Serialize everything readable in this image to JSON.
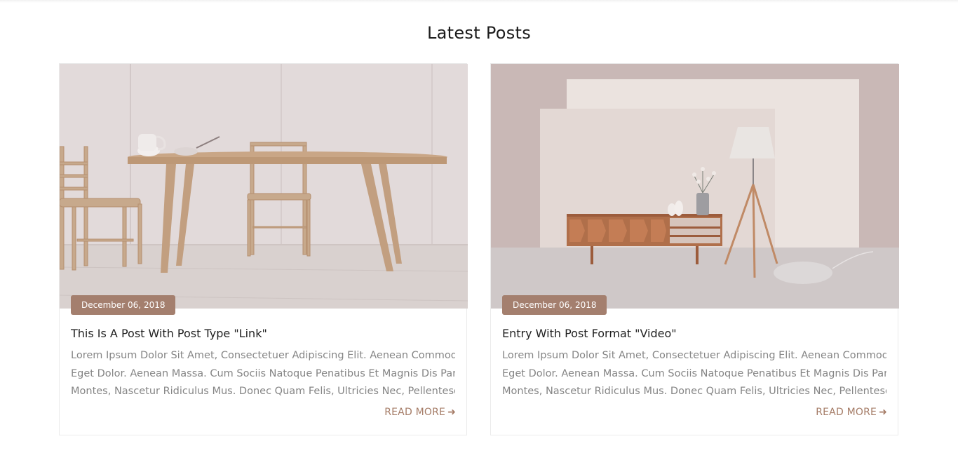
{
  "section": {
    "title": "Latest Posts"
  },
  "posts": [
    {
      "date": "December 06, 2018",
      "title": "This Is A Post With Post Type \"Link\"",
      "excerpt_lines": [
        "Lorem Ipsum Dolor Sit Amet, Consectetuer Adipiscing Elit. Aenean Commodo Ligula",
        "Eget Dolor. Aenean Massa. Cum Sociis Natoque Penatibus Et Magnis Dis Parturient",
        "Montes, Nascetur Ridiculus Mus. Donec Quam Felis, Ultricies Nec, Pellentesque Eu,.."
      ],
      "read_more": "READ MORE",
      "arrow_icon": "arrow-right-icon"
    },
    {
      "date": "December 06, 2018",
      "title": "Entry With Post Format \"Video\"",
      "excerpt_lines": [
        "Lorem Ipsum Dolor Sit Amet, Consectetuer Adipiscing Elit. Aenean Commodo Ligula",
        "Eget Dolor. Aenean Massa. Cum Sociis Natoque Penatibus Et Magnis Dis Parturient",
        "Montes, Nascetur Ridiculus Mus. Donec Quam Felis, Ultricies Nec, Pellentesque Eu,.."
      ],
      "read_more": "READ MORE",
      "arrow_icon": "arrow-right-icon"
    }
  ],
  "colors": {
    "accent": "#a47f6e",
    "read_more": "#a57c67",
    "text": "#1f1f1f",
    "muted": "#858585"
  }
}
